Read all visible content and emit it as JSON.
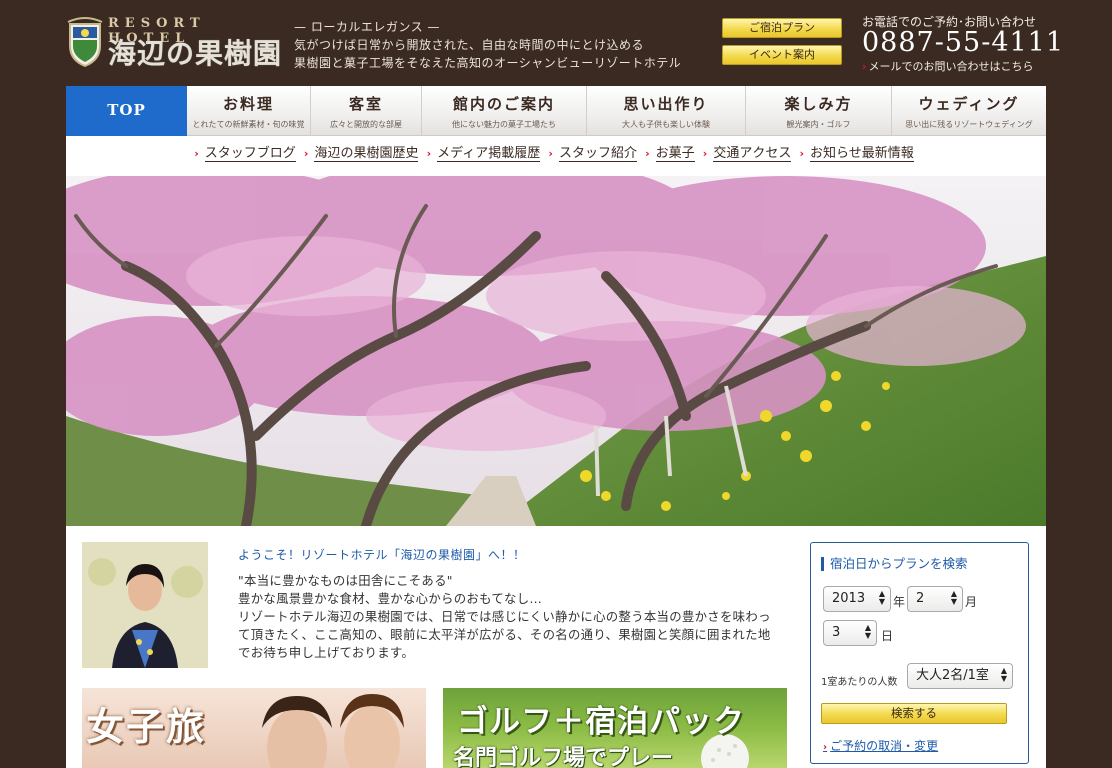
{
  "header": {
    "logo_eng": "RESORT HOTEL",
    "logo_jp": "海辺の果樹園",
    "tagline": [
      "— ローカルエレガンス —",
      "気がつけば日常から開放された、自由な時間の中にとけ込める",
      "果樹園と菓子工場をそなえた高知のオーシャンビューリゾートホテル"
    ],
    "btn_plan": "ご宿泊プラン",
    "btn_event": "イベント案内",
    "tel_label": "お電話でのご予約･お問い合わせ",
    "tel_number": "0887-55-4111",
    "mail_link": "メールでのお問い合わせはこちら"
  },
  "nav": {
    "top": "TOP",
    "items": [
      {
        "title": "お料理",
        "sub": "とれたての新鮮素材・旬の味覚"
      },
      {
        "title": "客室",
        "sub": "広々と開放的な部屋"
      },
      {
        "title": "館内のご案内",
        "sub": "他にない魅力の菓子工場たち"
      },
      {
        "title": "思い出作り",
        "sub": "大人も子供も楽しい体験"
      },
      {
        "title": "楽しみ方",
        "sub": "観光案内・ゴルフ"
      },
      {
        "title": "ウェディング",
        "sub": "思い出に残るリゾートウェディング"
      }
    ]
  },
  "subnav": [
    "スタッフブログ",
    "海辺の果樹園歴史",
    "メディア掲載履歴",
    "スタッフ紹介",
    "お菓子",
    "交通アクセス",
    "お知らせ最新情報"
  ],
  "welcome": {
    "title": "ようこそ！リゾートホテル「海辺の果樹園」へ！！",
    "lines": [
      "\"本当に豊かなものは田舎にこそある\"",
      "豊かな風景豊かな食材、豊かな心からのおもてなし…",
      "リゾートホテル海辺の果樹園では、日常では感じにくい静かに心の整う本当の豊かさを味わっ",
      "て頂きたく、ここ高知の、眼前に太平洋が広がる、その名の通り、果樹園と笑顔に囲まれた地",
      "でお待ち申し上げております。"
    ]
  },
  "banners": {
    "b1": "女子旅",
    "b2": "ゴルフ＋宿泊パック",
    "b2_sub": "名門ゴルフ場でプレー"
  },
  "search": {
    "title": "宿泊日からプランを検索",
    "year": "2013",
    "year_unit": "年",
    "month": "2",
    "month_unit": "月",
    "day": "3",
    "day_unit": "日",
    "guests_label": "1室あたりの人数",
    "guests_value": "大人2名/1室",
    "submit": "検索する",
    "cancel_link": "ご予約の取消・変更"
  }
}
